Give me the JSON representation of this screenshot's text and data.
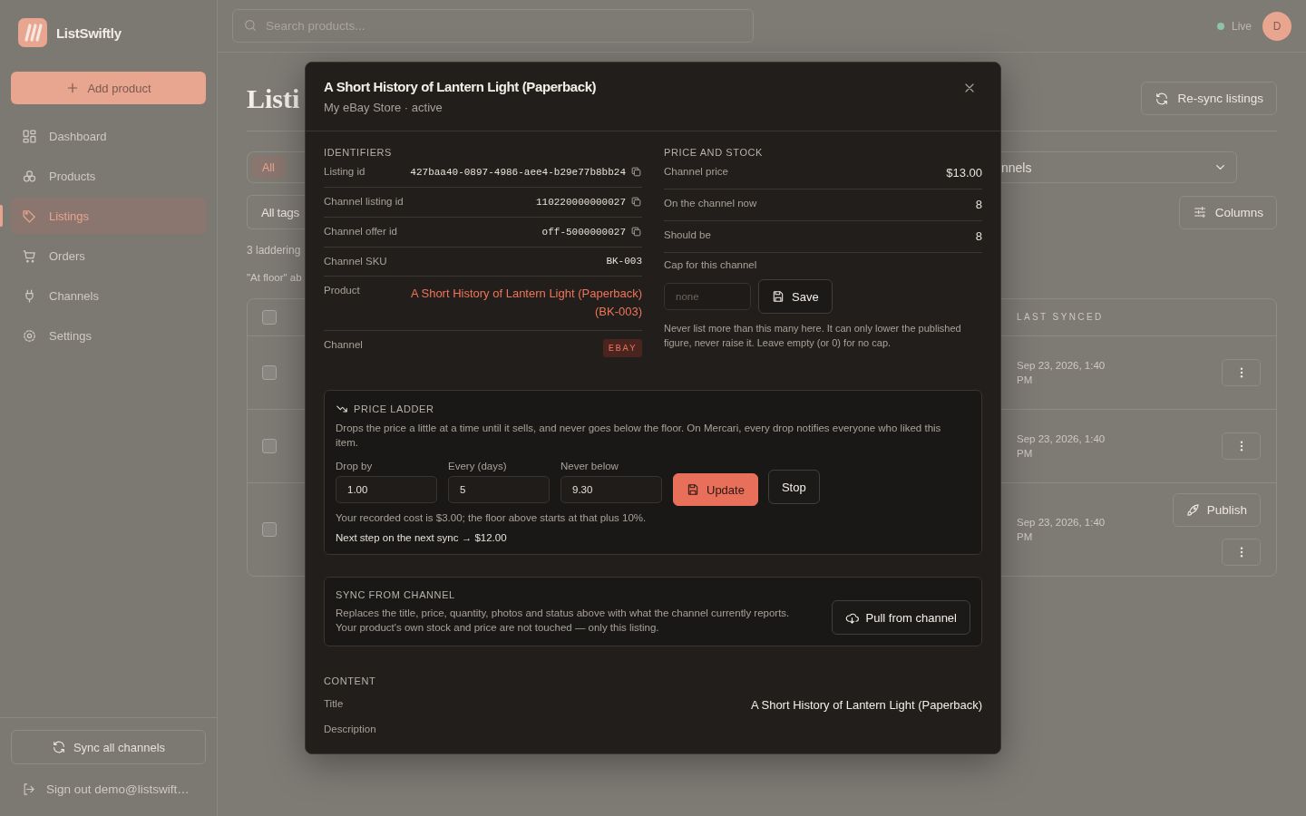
{
  "sidebar": {
    "brand": "ListSwiftly",
    "add_button": "Add product",
    "nav": [
      {
        "label": "Dashboard",
        "selected": false
      },
      {
        "label": "Products",
        "selected": false
      },
      {
        "label": "Listings",
        "selected": true
      },
      {
        "label": "Orders",
        "selected": false
      },
      {
        "label": "Channels",
        "selected": false
      },
      {
        "label": "Settings",
        "selected": false
      }
    ],
    "sync_button": "Sync all channels",
    "sign_out": "Sign out demo@listswift…"
  },
  "topbar": {
    "search_placeholder": "Search products...",
    "status": "Live",
    "avatar": "D"
  },
  "page": {
    "title": "Listi",
    "resync_button": "Re-sync listings",
    "filter_tabs": [
      {
        "label": "All",
        "selected": true
      }
    ],
    "channel_filter": "nnels",
    "tag_filter": "All tags",
    "columns_button": "Columns",
    "notes": [
      "3 laddering",
      "\"At floor\" ab"
    ],
    "table": {
      "columns": [
        "LAST SYNCED"
      ],
      "all_checked": false,
      "rows": [
        {
          "checked": false,
          "last_synced": "Sep 23, 2026, 1:40 PM"
        },
        {
          "checked": false,
          "last_synced": "Sep 23, 2026, 1:40 PM"
        },
        {
          "checked": false,
          "last_synced": "Sep 23, 2026, 1:40 PM",
          "publish_button": "Publish"
        }
      ]
    }
  },
  "modal": {
    "title": "A Short History of Lantern Light (Paperback)",
    "subtitle": "My eBay Store · active",
    "identifiers": {
      "heading": "IDENTIFIERS",
      "rows": [
        {
          "label": "Listing id",
          "value": "427baa40-0897-4986-aee4-b29e77b8bb24",
          "kind": "copy"
        },
        {
          "label": "Channel listing id",
          "value": "110220000000027",
          "kind": "copy"
        },
        {
          "label": "Channel offer id",
          "value": "off-5000000027",
          "kind": "copy"
        },
        {
          "label": "Channel SKU",
          "value": "BK-003",
          "kind": "mono"
        },
        {
          "label": "Product",
          "value": "A Short History of Lantern Light (Paperback) (BK-003)",
          "kind": "link"
        },
        {
          "label": "Channel",
          "value": "EBAY",
          "kind": "badge"
        }
      ]
    },
    "price_stock": {
      "heading": "PRICE AND STOCK",
      "rows": [
        {
          "label": "Channel price",
          "value": "$13.00"
        },
        {
          "label": "On the channel now",
          "value": "8"
        },
        {
          "label": "Should be",
          "value": "8"
        }
      ],
      "cap_label": "Cap for this channel",
      "cap_placeholder": "none",
      "save_button": "Save",
      "cap_help": "Never list more than this many here. It can only lower the published figure, never raise it. Leave empty (or 0) for no cap."
    },
    "ladder": {
      "heading": "PRICE LADDER",
      "description": "Drops the price a little at a time until it sells, and never goes below the floor. On Mercari, every drop notifies everyone who liked this item.",
      "fields": [
        {
          "label": "Drop by",
          "value": "1.00"
        },
        {
          "label": "Every (days)",
          "value": "5"
        },
        {
          "label": "Never below",
          "value": "9.30"
        }
      ],
      "update_button": "Update",
      "stop_button": "Stop",
      "cost_note": "Your recorded cost is $3.00; the floor above starts at that plus 10%.",
      "next_step": "Next step on the next sync → $12.00"
    },
    "sync": {
      "heading": "SYNC FROM CHANNEL",
      "description": "Replaces the title, price, quantity, photos and status above with what the channel currently reports. Your product's own stock and price are not touched — only this listing.",
      "button": "Pull from channel"
    },
    "content": {
      "heading": "CONTENT",
      "fields": [
        {
          "label": "Title",
          "value": "A Short History of Lantern Light (Paperback)"
        },
        {
          "label": "Description"
        }
      ]
    }
  }
}
